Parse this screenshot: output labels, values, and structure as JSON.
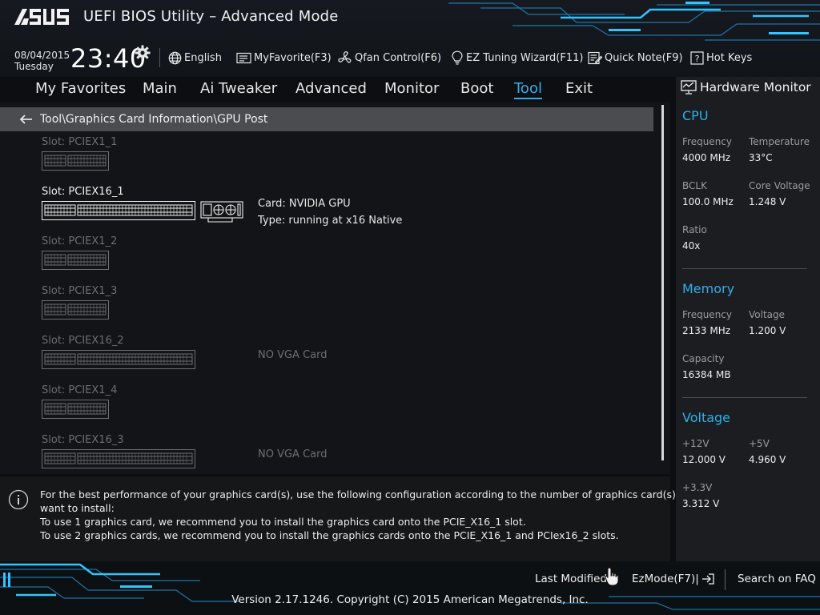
{
  "header": {
    "title": "UEFI BIOS Utility – Advanced Mode",
    "date": "08/04/2015",
    "day": "Tuesday",
    "time": "23:40",
    "toolbar": [
      {
        "id": "english",
        "label": "English",
        "icon": "globe-icon"
      },
      {
        "id": "myfavorite",
        "label": "MyFavorite(F3)",
        "icon": "favorite-icon"
      },
      {
        "id": "qfan",
        "label": "Qfan Control(F6)",
        "icon": "fan-icon"
      },
      {
        "id": "eztuning",
        "label": "EZ Tuning Wizard(F11)",
        "icon": "bulb-icon"
      },
      {
        "id": "quicknote",
        "label": "Quick Note(F9)",
        "icon": "note-icon"
      },
      {
        "id": "hotkeys",
        "label": "Hot Keys",
        "icon": "help-icon"
      }
    ]
  },
  "nav": {
    "tabs": [
      "My Favorites",
      "Main",
      "Ai Tweaker",
      "Advanced",
      "Monitor",
      "Boot",
      "Tool",
      "Exit"
    ],
    "active": "Tool"
  },
  "breadcrumb": "Tool\\Graphics Card Information\\GPU Post",
  "slots": [
    {
      "label": "Slot: PCIEX1_1",
      "type": "x1",
      "active": false,
      "card": "",
      "card_type": ""
    },
    {
      "label": "Slot: PCIEX16_1",
      "type": "x16",
      "active": true,
      "card": "Card: NVIDIA GPU",
      "card_type": "Type: running at x16 Native"
    },
    {
      "label": "Slot: PCIEX1_2",
      "type": "x1",
      "active": false,
      "card": "",
      "card_type": ""
    },
    {
      "label": "Slot: PCIEX1_3",
      "type": "x1",
      "active": false,
      "card": "",
      "card_type": ""
    },
    {
      "label": "Slot: PCIEX16_2",
      "type": "x16",
      "active": false,
      "card": "NO VGA Card",
      "card_type": ""
    },
    {
      "label": "Slot: PCIEX1_4",
      "type": "x1",
      "active": false,
      "card": "",
      "card_type": ""
    },
    {
      "label": "Slot: PCIEX16_3",
      "type": "x16",
      "active": false,
      "card": "NO VGA Card",
      "card_type": ""
    }
  ],
  "info": {
    "lines": [
      "For the best performance of your graphics card(s), use the following configuration according to the number of graphics card(s) you",
      "want to install:",
      "To use 1 graphics card, we recommend you to install  the graphics card onto the PCIE_X16_1 slot.",
      "To use 2 graphics cards, we recommend you to install the graphics cards onto the PCIE_X16_1 and PCIex16_2 slots."
    ]
  },
  "hwmonitor": {
    "title": "Hardware Monitor",
    "cpu": {
      "heading": "CPU",
      "frequency_label": "Frequency",
      "frequency": "4000 MHz",
      "temperature_label": "Temperature",
      "temperature": "33°C",
      "bclk_label": "BCLK",
      "bclk": "100.0 MHz",
      "core_voltage_label": "Core Voltage",
      "core_voltage": "1.248 V",
      "ratio_label": "Ratio",
      "ratio": "40x"
    },
    "memory": {
      "heading": "Memory",
      "frequency_label": "Frequency",
      "frequency": "2133 MHz",
      "voltage_label": "Voltage",
      "voltage": "1.200 V",
      "capacity_label": "Capacity",
      "capacity": "16384 MB"
    },
    "voltage": {
      "heading": "Voltage",
      "v12_label": "+12V",
      "v12": "12.000 V",
      "v5_label": "+5V",
      "v5": "4.960 V",
      "v33_label": "+3.3V",
      "v33": "3.312 V"
    }
  },
  "footer": {
    "last_modified": "Last Modified",
    "ezmode": "EzMode(F7)|",
    "search_faq": "Search on FAQ",
    "copyright": "Version 2.17.1246. Copyright (C) 2015 American Megatrends, Inc."
  },
  "colors": {
    "accent": "#2fb0ea",
    "dim_text": "#6c6e72",
    "panel": "#1b1d21",
    "breadcrumb_bg": "#4a4c50"
  }
}
